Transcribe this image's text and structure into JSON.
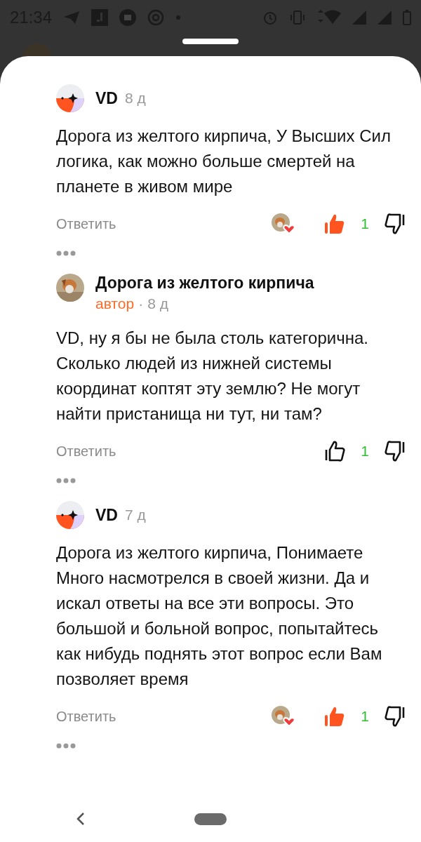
{
  "status_bar": {
    "time": "21:34"
  },
  "comments": [
    {
      "author": "VD",
      "avatar": {
        "kind": "logo"
      },
      "is_author": false,
      "time": "8 д",
      "text": "Дорога из желтого кирпича, У Высших Сил логика, как можно больше смертей на планете в живом мире",
      "reply": "Ответить",
      "liked_by_author": true,
      "liked": true,
      "likes": "1"
    },
    {
      "author": "Дорога из желтого кирпича",
      "is_author": true,
      "author_label": "автор",
      "separator": "·",
      "time": "8 д",
      "text": "VD, ну я бы не была столь категорична. Сколько людей из нижней системы координат коптят эту землю? Не могут найти пристанища ни тут, ни там?",
      "reply": "Ответить",
      "liked_by_author": false,
      "liked": false,
      "likes": "1"
    },
    {
      "author": "VD",
      "avatar": {
        "kind": "logo"
      },
      "is_author": false,
      "time": "7 д",
      "text": "Дорога из желтого кирпича, Понимаете Много насмотрелся в своей жизни. Да и искал ответы на все эти вопросы. Это большой и больной вопрос, попытайтесь как нибудь поднять этот вопрос если Вам позволяет время",
      "reply": "Ответить",
      "liked_by_author": true,
      "liked": true,
      "likes": "1"
    }
  ]
}
